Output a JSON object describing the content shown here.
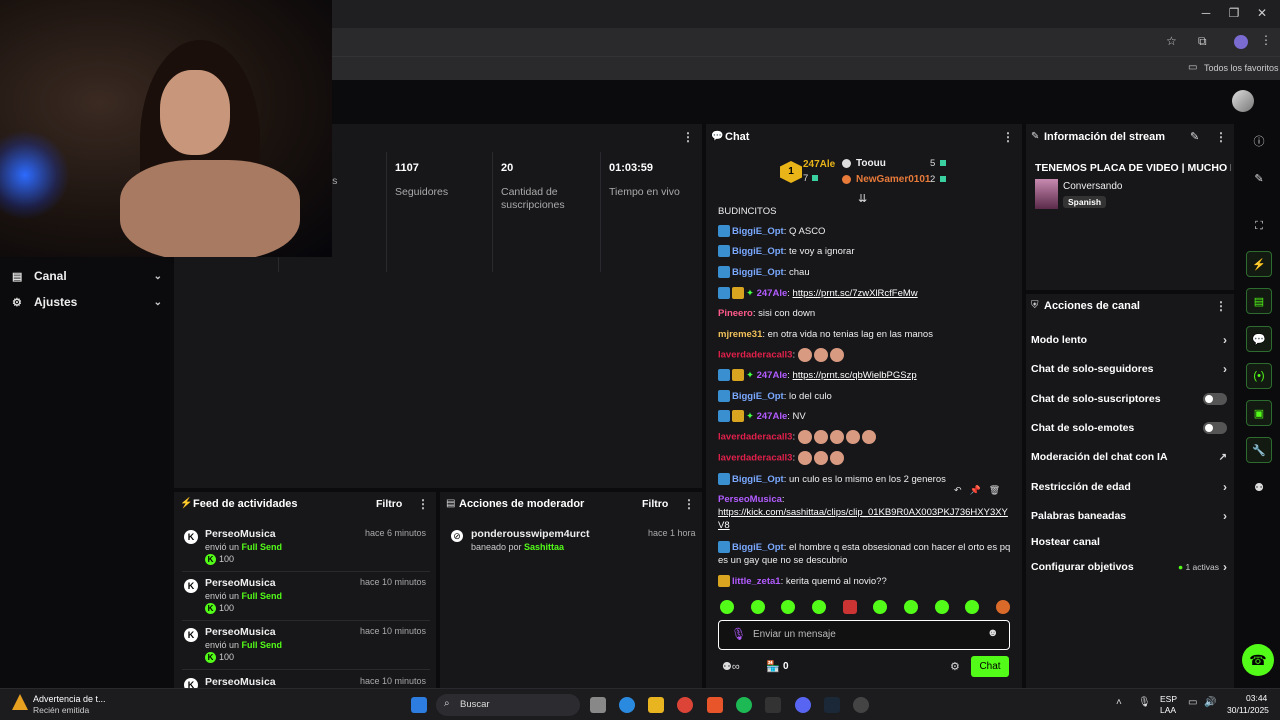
{
  "browser": {
    "bookmarks_label": "Todos los favoritos"
  },
  "nav": {
    "canal": "Canal",
    "ajustes": "Ajustes"
  },
  "stats": [
    {
      "value": "",
      "label": "ores"
    },
    {
      "value": "1107",
      "label": "Seguidores"
    },
    {
      "value": "20",
      "label": "Cantidad de suscripciones"
    },
    {
      "value": "01:03:59",
      "label": "Tiempo en vivo"
    }
  ],
  "chat": {
    "title": "Chat",
    "top1_name": "247Ale",
    "top1_count": "7",
    "top1_rank": "1",
    "top2_name": "Toouu",
    "top2_count": "5",
    "top3_name": "NewGamer0101",
    "top3_count": "2",
    "placeholder": "Enviar un mensaje",
    "send": "Chat",
    "points": "0",
    "messages": [
      {
        "user": "BUDINCITOS",
        "text": "",
        "color": "#eeeeee"
      },
      {
        "user": "BiggiE_Opt",
        "text": ": Q ASCO",
        "color": "#7aa9ff"
      },
      {
        "user": "BiggiE_Opt",
        "text": ": te voy a ignorar",
        "color": "#7aa9ff"
      },
      {
        "user": "BiggiE_Opt",
        "text": ": chau",
        "color": "#7aa9ff"
      },
      {
        "user": "247Ale",
        "text": "https://prnt.sc/7zwXlRcfFeMw",
        "color": "#b25cff"
      },
      {
        "user": "Pineero",
        "text": ": sisi con down",
        "color": "#ff5a8a"
      },
      {
        "user": "mjreme31",
        "text": ": en otra vida no tenias lag en las manos",
        "color": "#f0c05a"
      },
      {
        "user": "laverdaderacall3",
        "text": ":",
        "color": "#e0204a"
      },
      {
        "user": "247Ale",
        "text": "https://prnt.sc/qbWielbPGSzp",
        "color": "#b25cff"
      },
      {
        "user": "BiggiE_Opt",
        "text": ": lo del culo",
        "color": "#7aa9ff"
      },
      {
        "user": "247Ale",
        "text": ": NV",
        "color": "#b25cff"
      },
      {
        "user": "laverdaderacall3",
        "text": ":",
        "color": "#e0204a"
      },
      {
        "user": "laverdaderacall3",
        "text": ":",
        "color": "#e0204a"
      },
      {
        "user": "BiggiE_Opt",
        "text": ": un culo es lo mismo en los 2 generos",
        "color": "#7aa9ff"
      },
      {
        "user": "PerseoMusica",
        "text": ":",
        "link": "https://kick.com/sashittaa/clips/clip_01KB9R0AX003PKJ736HXY3XYV8",
        "color": "#b25cff"
      },
      {
        "user": "BiggiE_Opt",
        "text": ": el hombre q esta obsesionad con hacer el orto es pq es un gay que no se descubrio",
        "color": "#7aa9ff"
      },
      {
        "user": "little_zeta1",
        "text": ": kerita quemó al novio??",
        "color": "#b25cff"
      }
    ]
  },
  "info": {
    "title": "Información del stream",
    "stream_title": "TENEMOS PLACA DE VIDEO | MUCHO FN",
    "category": "Conversando",
    "language": "Spanish"
  },
  "acciones": {
    "title": "Acciones de canal",
    "items": [
      "Modo lento",
      "Chat de solo-seguidores",
      "Chat de solo-suscriptores",
      "Chat de solo-emotes",
      "Moderación del chat con IA",
      "Restricción de edad",
      "Palabras baneadas",
      "Hostear canal",
      "Configurar objetivos"
    ],
    "objetivos_badge": "1 activas"
  },
  "feed": {
    "title": "Feed de actividades",
    "filter": "Filtro",
    "items": [
      {
        "name": "PerseoMusica",
        "time": "hace 6 minutos",
        "sent": "envió un ",
        "gift": "Full Send",
        "amount": "100"
      },
      {
        "name": "PerseoMusica",
        "time": "hace 10 minutos",
        "sent": "envió un ",
        "gift": "Full Send",
        "amount": "100"
      },
      {
        "name": "PerseoMusica",
        "time": "hace 10 minutos",
        "sent": "envió un ",
        "gift": "Full Send",
        "amount": "100"
      },
      {
        "name": "PerseoMusica",
        "time": "hace 10 minutos",
        "sent": "",
        "gift": "",
        "amount": ""
      }
    ]
  },
  "mod": {
    "title": "Acciones de moderador",
    "filter": "Filtro",
    "user": "ponderousswipem4urct",
    "time": "hace 1 hora",
    "banned_by": "baneado por ",
    "moderator": "Sashittaa"
  },
  "taskbar": {
    "notif_title": "Advertencia de t...",
    "notif_sub": "Recién emitida",
    "search": "Buscar",
    "lang1": "ESP",
    "lang2": "LAA",
    "time": "03:44",
    "date": "30/11/2025"
  },
  "colors": {
    "accent": "#53fc18",
    "panel": "#17171a"
  }
}
